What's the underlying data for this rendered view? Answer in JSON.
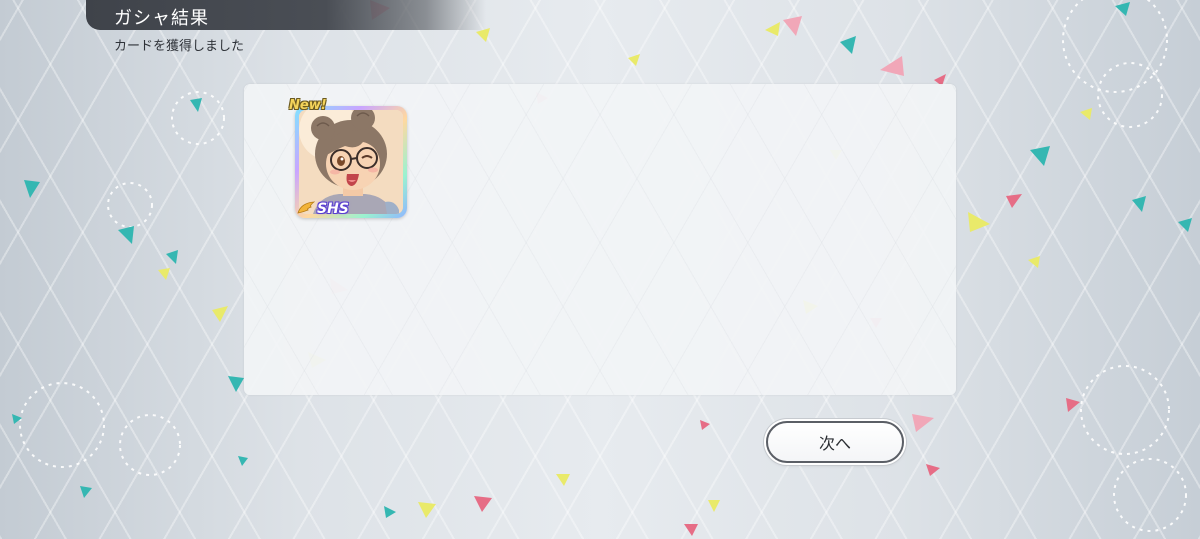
{
  "header": {
    "title": "ガシャ結果",
    "subtitle": "カードを獲得しました"
  },
  "result_panel": {
    "cards": [
      {
        "badge": "New!",
        "rarity": "SHS",
        "portrait": "character-portrait-glasses-hair-buns-winking"
      }
    ]
  },
  "actions": {
    "next_label": "次へ"
  },
  "colors": {
    "title_bar": "#44484f",
    "button_border": "#5b5f66",
    "rarity_glow": "#5a3fd0",
    "new_badge": "#f3d35a"
  }
}
